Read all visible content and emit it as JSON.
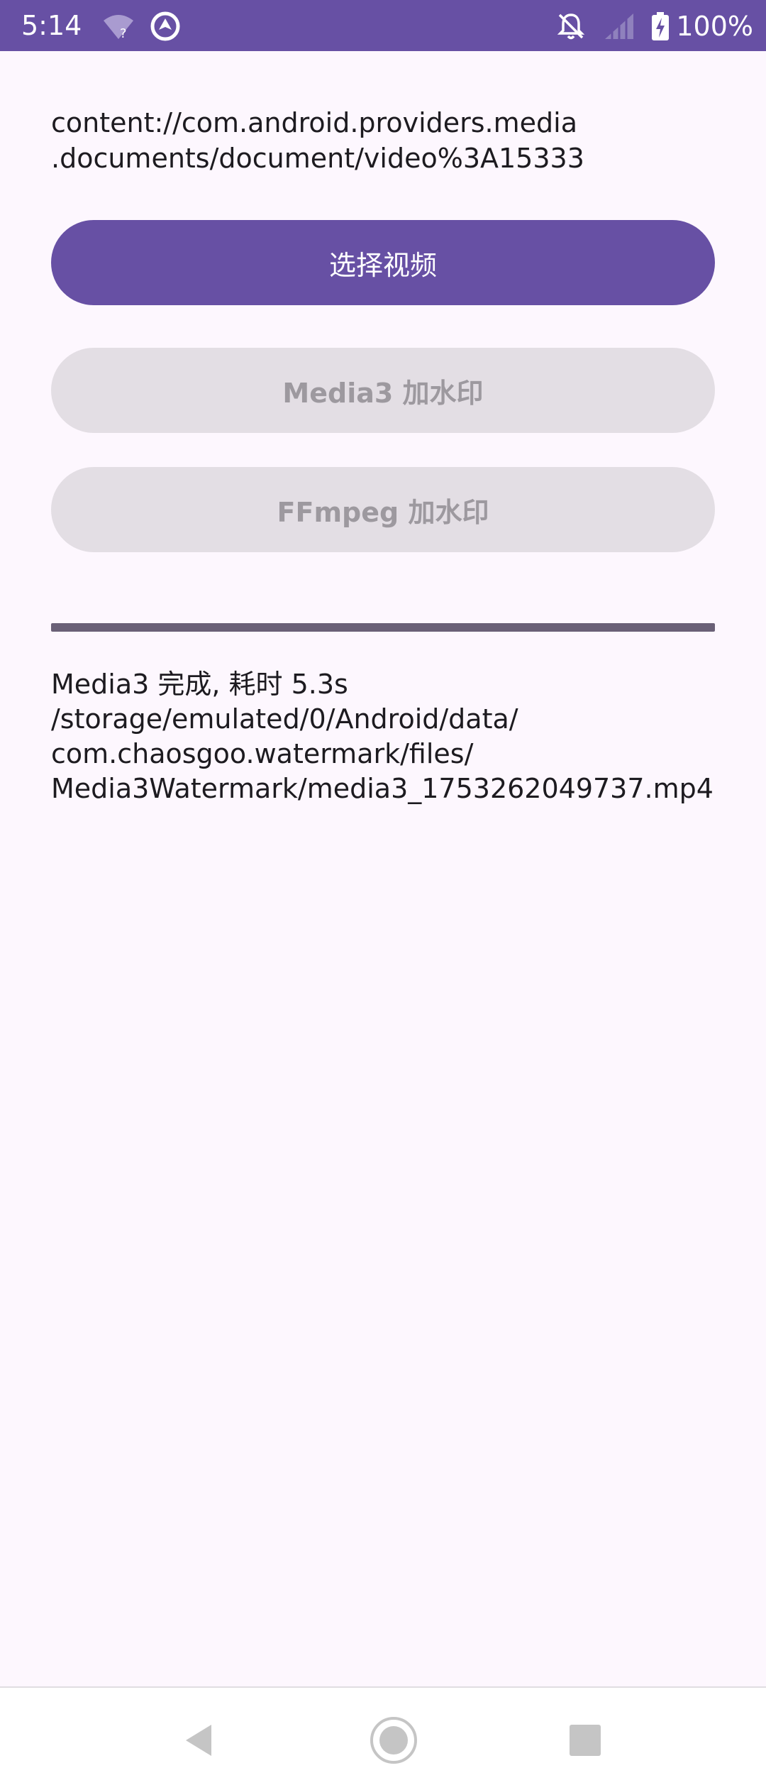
{
  "status_bar": {
    "time": "5:14",
    "battery": "100%",
    "icons": [
      "wifi-unknown-icon",
      "data-saver-icon",
      "notifications-off-icon",
      "signal-icon",
      "battery-charging-icon"
    ],
    "background": "#6750a4"
  },
  "main": {
    "uri_text": "content://com.android.providers.media\n.documents/document/video%3A15333",
    "buttons": {
      "select_video": "选择视频",
      "media3_watermark": "Media3 加水印",
      "ffmpeg_watermark": "FFmpeg 加水印"
    },
    "progress": 1.0,
    "result_lines": [
      "Media3 完成, 耗时 5.3s",
      "/storage/emulated/0/Android/data/",
      "com.chaosgoo.watermark/files/",
      "Media3Watermark/media3_1753262049737.mp4"
    ]
  },
  "nav_bar": {
    "icons": [
      "back-icon",
      "home-icon",
      "recents-icon"
    ]
  },
  "colors": {
    "primary": "#6750a4",
    "disabled_bg": "#e3dee4",
    "disabled_text": "#9d999f",
    "page_bg": "#fdf7fe",
    "progress": "#6a6077"
  }
}
